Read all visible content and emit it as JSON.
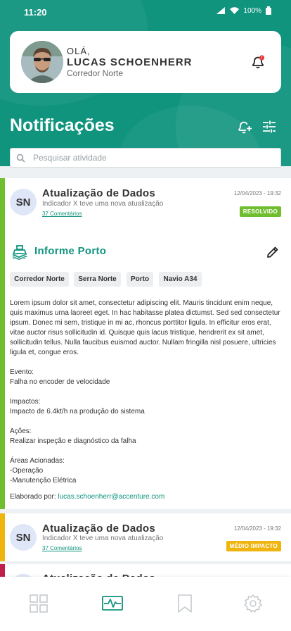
{
  "status_bar": {
    "time": "11:20",
    "battery": "100%"
  },
  "profile": {
    "greeting": "OLÁ,",
    "name": "LUCAS SCHOENHERR",
    "role": "Corredor Norte",
    "bell_badge": "!"
  },
  "page": {
    "title": "Notificações"
  },
  "search": {
    "placeholder": "Pesquisar atividade",
    "value": ""
  },
  "cards": [
    {
      "initials": "SN",
      "title": "Atualização de Dados",
      "subtitle": "Indicador X teve uma nova atualização",
      "comments": "37 Comentários",
      "date": "12/04/2023 - 19:32",
      "badge": "RESOLVIDO",
      "accent": "#6fbe2e"
    },
    {
      "initials": "SN",
      "title": "Atualização de Dados",
      "subtitle": "Indicador X teve uma nova atualização",
      "comments": "37 Comentários",
      "date": "12/04/2023 - 19:32",
      "badge": "MÉDIO IMPACTO",
      "accent": "#f0b40f"
    },
    {
      "initials": "SN",
      "title": "Atualização de Dados",
      "accent": "#c01f4c"
    }
  ],
  "report": {
    "title": "Informe Porto",
    "tags": [
      "Corredor Norte",
      "Serra Norte",
      "Porto",
      "Navio A34"
    ],
    "intro": "Lorem ipsum dolor sit amet, consectetur adipiscing elit. Mauris tincidunt enim neque, quis maximus urna laoreet eget. In hac habitasse platea dictumst. Sed sed consectetur ipsum. Donec mi sem, tristique in mi ac, rhoncus porttitor ligula. In efficitur eros erat, vitae auctor risus sollicitudin id. Quisque quis lacus tristique, hendrerit ex sit amet, sollicitudin tellus. Nulla faucibus euismod auctor. Nullam fringilla nisl posuere, ultricies ligula et, congue eros.",
    "event_label": "Evento:",
    "event_value": "Falha no encoder de velocidade",
    "impacts_label": "Impactos:",
    "impacts_value": "Impacto de 6.4kt/h na produção do sistema",
    "actions_label": "Ações:",
    "actions_value": "Realizar inspeção e diagnóstico da falha",
    "areas_label": "Áreas Acionadas:",
    "areas": [
      "-Operação",
      "-Manutenção Elétrica"
    ],
    "author_label": "Elaborado por:",
    "author_email": "lucas.schoenherr@accenture.com"
  },
  "colors": {
    "primary": "#10947e",
    "resolved": "#6fbe2e",
    "medium": "#f0b40f",
    "high": "#c01f4c"
  },
  "nav": {
    "items": [
      "grid-icon",
      "activity-icon",
      "bookmark-icon",
      "settings-icon"
    ],
    "active": "activity-icon"
  }
}
